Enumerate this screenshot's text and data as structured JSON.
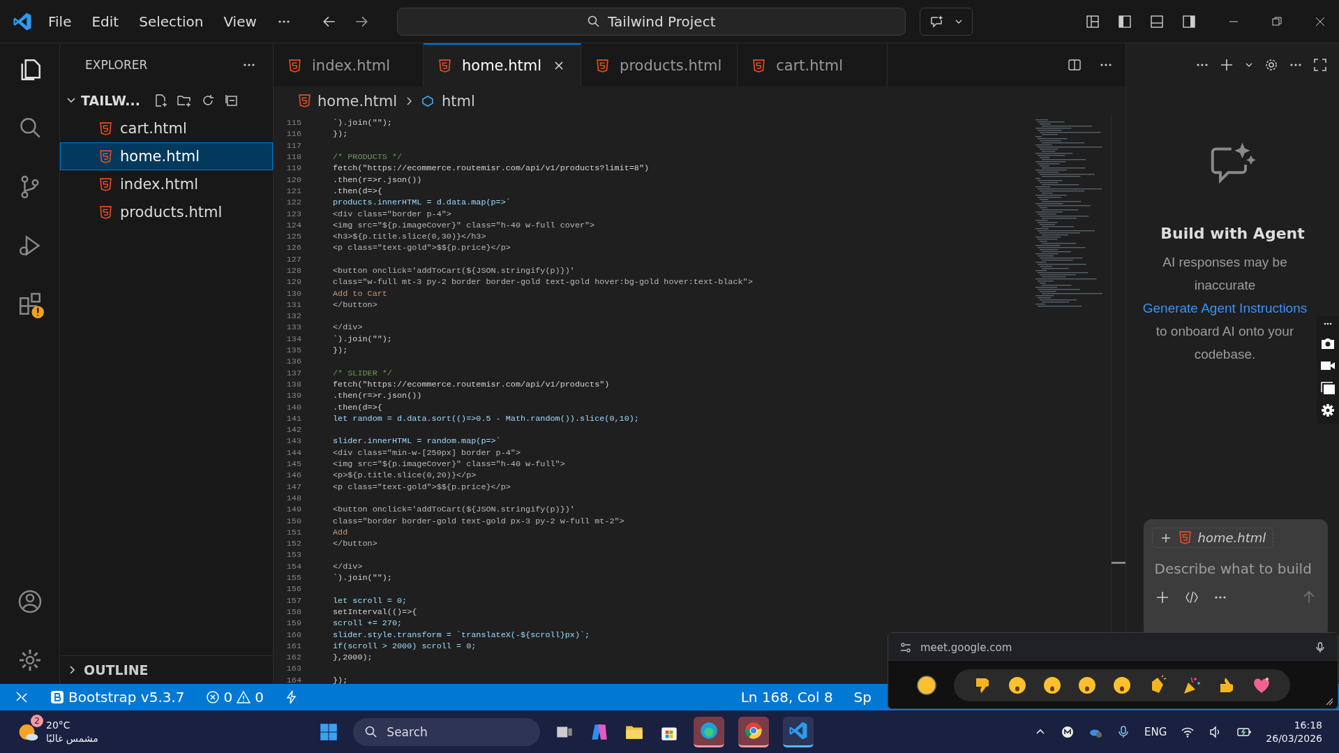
{
  "menu": [
    "File",
    "Edit",
    "Selection",
    "View"
  ],
  "command_center": "Tailwind Project",
  "sidebar": {
    "title": "EXPLORER",
    "folder": {
      "name": "TAILW...",
      "expanded": true,
      "files": [
        {
          "name": "cart.html",
          "selected": false
        },
        {
          "name": "home.html",
          "selected": true
        },
        {
          "name": "index.html",
          "selected": false
        },
        {
          "name": "products.html",
          "selected": false
        }
      ]
    },
    "outline": {
      "label": "OUTLINE",
      "expanded": false
    }
  },
  "tabs": [
    {
      "label": "index.html",
      "selected": false
    },
    {
      "label": "home.html",
      "selected": true
    },
    {
      "label": "products.html",
      "selected": false
    },
    {
      "label": "cart.html",
      "selected": false
    }
  ],
  "breadcrumb": [
    "home.html",
    "html"
  ],
  "code": [
    {
      "n": "115",
      "text": "`).join(\"\");",
      "kind": "code"
    },
    {
      "n": "116",
      "text": "});",
      "kind": "code"
    },
    {
      "n": "117"
    },
    {
      "n": "118",
      "text": "/* PRODUCTS */",
      "kind": "comment"
    },
    {
      "n": "119",
      "text": "fetch(\"https://ecommerce.routemisr.com/api/v1/products?limit=8\")",
      "kind": "code"
    },
    {
      "n": "120",
      "text": ".then(r=>r.json())",
      "kind": "code"
    },
    {
      "n": "121",
      "text": ".then(d=>{",
      "kind": "code"
    },
    {
      "n": "122",
      "text": "products.innerHTML = d.data.map(p=>`",
      "kind": "js"
    },
    {
      "n": "123",
      "text": "<div class=\"border p-4\">",
      "kind": "markup"
    },
    {
      "n": "124",
      "text": "<img src=\"${p.imageCover}\" class=\"h-40 w-full cover\">",
      "kind": "markup"
    },
    {
      "n": "125",
      "text": "<h3>${p.title.slice(0,30)}</h3>",
      "kind": "markup"
    },
    {
      "n": "126",
      "text": "<p class=\"text-gold\">$${p.price}</p>",
      "kind": "markup"
    },
    {
      "n": "127"
    },
    {
      "n": "128",
      "text": "<button onclick='addToCart(${JSON.stringify(p)})'",
      "kind": "markup"
    },
    {
      "n": "129",
      "text": "class=\"w-full mt-3 py-2 border border-gold text-gold hover:bg-gold hover:text-black\">",
      "kind": "markup"
    },
    {
      "n": "130",
      "text": "Add to Cart",
      "kind": "string"
    },
    {
      "n": "131",
      "text": "</button>",
      "kind": "markup"
    },
    {
      "n": "132"
    },
    {
      "n": "133",
      "text": "</div>",
      "kind": "markup"
    },
    {
      "n": "134",
      "text": "`).join(\"\");",
      "kind": "code"
    },
    {
      "n": "135",
      "text": "});",
      "kind": "code"
    },
    {
      "n": "136"
    },
    {
      "n": "137",
      "text": "/* SLIDER */",
      "kind": "comment"
    },
    {
      "n": "138",
      "text": "fetch(\"https://ecommerce.routemisr.com/api/v1/products\")",
      "kind": "code"
    },
    {
      "n": "139",
      "text": ".then(r=>r.json())",
      "kind": "code"
    },
    {
      "n": "140",
      "text": ".then(d=>{",
      "kind": "code"
    },
    {
      "n": "141",
      "text": "let random = d.data.sort(()=>0.5 - Math.random()).slice(0,10);",
      "kind": "js"
    },
    {
      "n": "142"
    },
    {
      "n": "143",
      "text": "slider.innerHTML = random.map(p=>`",
      "kind": "js"
    },
    {
      "n": "144",
      "text": "<div class=\"min-w-[250px] border p-4\">",
      "kind": "markup"
    },
    {
      "n": "145",
      "text": "<img src=\"${p.imageCover}\" class=\"h-40 w-full\">",
      "kind": "markup"
    },
    {
      "n": "146",
      "text": "<p>${p.title.slice(0,20)}</p>",
      "kind": "markup"
    },
    {
      "n": "147",
      "text": "<p class=\"text-gold\">$${p.price}</p>",
      "kind": "markup"
    },
    {
      "n": "148"
    },
    {
      "n": "149",
      "text": "<button onclick='addToCart(${JSON.stringify(p)})'",
      "kind": "markup"
    },
    {
      "n": "150",
      "text": "class=\"border border-gold text-gold px-3 py-2 w-full mt-2\">",
      "kind": "markup"
    },
    {
      "n": "151",
      "text": "Add",
      "kind": "string"
    },
    {
      "n": "152",
      "text": "</button>",
      "kind": "markup"
    },
    {
      "n": "153"
    },
    {
      "n": "154",
      "text": "</div>",
      "kind": "markup"
    },
    {
      "n": "155",
      "text": "`).join(\"\");",
      "kind": "code"
    },
    {
      "n": "156"
    },
    {
      "n": "157",
      "text": "let scroll = 0;",
      "kind": "js"
    },
    {
      "n": "158",
      "text": "setInterval(()=>{",
      "kind": "code"
    },
    {
      "n": "159",
      "text": "scroll += 270;",
      "kind": "js"
    },
    {
      "n": "160",
      "text": "slider.style.transform = `translateX(-${scroll}px)`;",
      "kind": "js"
    },
    {
      "n": "161",
      "text": "if(scroll > 2000) scroll = 0;",
      "kind": "js"
    },
    {
      "n": "162",
      "text": "},2000);",
      "kind": "code"
    },
    {
      "n": "163"
    },
    {
      "n": "164",
      "text": "});",
      "kind": "code"
    }
  ],
  "agent_panel": {
    "title": "Build with Agent",
    "text_1": "AI responses may be inaccurate",
    "link": "Generate Agent Instructions",
    "text_2": "to onboard AI onto your codebase.",
    "chat": {
      "attachment": "home.html",
      "placeholder": "Describe what to build"
    }
  },
  "status_bar": {
    "extension": "Bootstrap v5.3.7",
    "errors": "0",
    "warnings": "0",
    "cursor": "Ln 168, Col 8",
    "indent": "Sp"
  },
  "meet_bar": {
    "url": "meet.google.com"
  },
  "taskbar": {
    "weather": {
      "temp": "20°C",
      "condition": "مشمس غالبًا",
      "badge": "2"
    },
    "search": "Search",
    "language": "ENG",
    "time": "16:18",
    "date": "26/03/2026"
  }
}
